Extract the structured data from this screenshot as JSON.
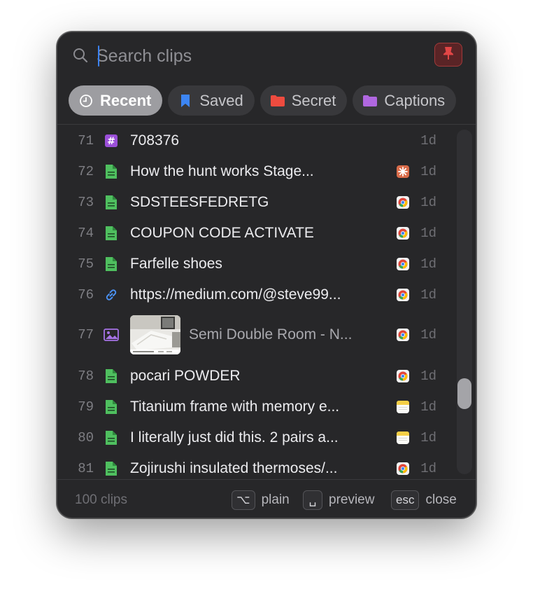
{
  "search": {
    "placeholder": "Search clips",
    "value": ""
  },
  "tabs": [
    {
      "label": "Recent",
      "icon": "clock-icon",
      "active": true
    },
    {
      "label": "Saved",
      "icon": "bookmark-icon"
    },
    {
      "label": "Secret",
      "icon": "folder-icon",
      "color": "#ee4b3f"
    },
    {
      "label": "Captions",
      "icon": "folder-icon",
      "color": "#b067e0"
    }
  ],
  "clips": [
    {
      "num": "71",
      "type": "hash-icon",
      "text": "708376",
      "source": "",
      "age": "1d"
    },
    {
      "num": "72",
      "type": "document-icon",
      "text": "How the hunt works  Stage...",
      "source": "claude-icon",
      "age": "1d"
    },
    {
      "num": "73",
      "type": "document-icon",
      "text": "SDSTEESFEDRETG",
      "source": "chrome-icon",
      "age": "1d"
    },
    {
      "num": "74",
      "type": "document-icon",
      "text": "COUPON CODE ACTIVATE",
      "source": "chrome-icon",
      "age": "1d"
    },
    {
      "num": "75",
      "type": "document-icon",
      "text": "Farfelle shoes",
      "source": "chrome-icon",
      "age": "1d"
    },
    {
      "num": "76",
      "type": "link-icon",
      "text": "https://medium.com/@steve99...",
      "source": "chrome-icon",
      "age": "1d"
    },
    {
      "num": "77",
      "type": "image-icon",
      "text": "Semi Double Room - N...",
      "source": "chrome-icon",
      "age": "1d"
    },
    {
      "num": "78",
      "type": "document-icon",
      "text": "pocari POWDER",
      "source": "chrome-icon",
      "age": "1d"
    },
    {
      "num": "79",
      "type": "document-icon",
      "text": "Titanium frame with memory e...",
      "source": "notes-icon",
      "age": "1d"
    },
    {
      "num": "80",
      "type": "document-icon",
      "text": "I literally just did this. 2 pairs a...",
      "source": "notes-icon",
      "age": "1d"
    },
    {
      "num": "81",
      "type": "document-icon",
      "text": "Zojirushi insulated thermoses/...",
      "source": "chrome-icon",
      "age": "1d"
    }
  ],
  "footer": {
    "count": "100 clips",
    "plain_key": "⌥",
    "plain_label": "plain",
    "preview_key": "␣",
    "preview_label": "preview",
    "close_key": "esc",
    "close_label": "close"
  },
  "colors": {
    "background": "#272729",
    "accent": "#3b82f6",
    "document": "#4fbf5f",
    "hash": "#9b4fd8",
    "pin": "#e24646"
  }
}
